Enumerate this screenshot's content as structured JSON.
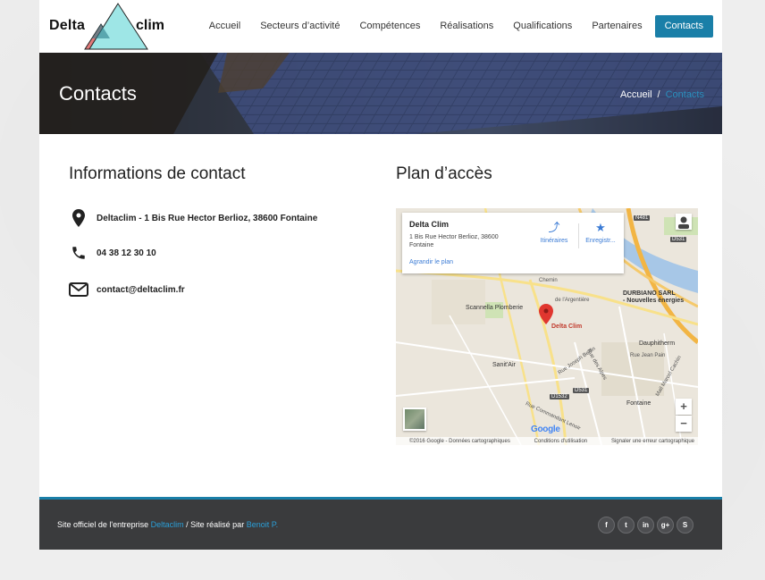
{
  "logo": {
    "text_left": "Delta",
    "text_right": "clim"
  },
  "nav": {
    "items": [
      {
        "label": "Accueil"
      },
      {
        "label": "Secteurs d’activité"
      },
      {
        "label": "Compétences"
      },
      {
        "label": "Réalisations"
      },
      {
        "label": "Qualifications"
      },
      {
        "label": "Partenaires"
      },
      {
        "label": "Contacts"
      }
    ],
    "active": "Contacts",
    "active_color": "#1a7fa8"
  },
  "banner": {
    "title": "Contacts",
    "breadcrumb": {
      "home": "Accueil",
      "separator": "/",
      "current": "Contacts"
    }
  },
  "contact_info": {
    "heading": "Informations de contact",
    "address": "Deltaclim - 1 Bis Rue Hector Berlioz, 38600 Fontaine",
    "phone": "04 38 12 30 10",
    "email": "contact@deltaclim.fr",
    "icons": [
      "map-pin-icon",
      "phone-icon",
      "envelope-icon"
    ]
  },
  "access": {
    "heading": "Plan d’accès",
    "map": {
      "card": {
        "name": "Delta Clim",
        "address_line1": "1 Bis Rue Hector Berlioz, 38600",
        "address_line2": "Fontaine",
        "enlarge": "Agrandir le plan",
        "directions": "Itinéraires",
        "save": "Enregistr..."
      },
      "labels": {
        "marker": "Delta Clim",
        "scannella": "Scannella Plomberie",
        "durbiano": "DURBIANO SARL",
        "nouvelles": "- Nouvelles énergies",
        "dauphitherm": "Dauphitherm",
        "sanitair": "Sanit'Air",
        "fontaine": "Fontaine",
        "chemin": "Chemin",
        "argentiere": "de l'Argentière",
        "rue_jean_pain": "Rue Jean Pain",
        "joseph_bertin": "Rue Joseph Bertin",
        "rue_alpes": "Rue des Alpes",
        "marcel_cachin": "Mail Marcel Cachin",
        "commandant_lenoir": "Rue Commandant Lenoir",
        "n481": "N481",
        "d531_top": "D531",
        "d531_bottom": "D531",
        "d1532": "D1532"
      },
      "zoom_in": "+",
      "zoom_out": "−",
      "google": "Google",
      "attribution_left": "©2016 Google - Données cartographiques",
      "attribution_mid": "Conditions d'utilisation",
      "attribution_right": "Signaler une erreur cartographique"
    }
  },
  "footer": {
    "prefix": "Site officiel de l'entreprise",
    "company_link": "Deltaclim",
    "middle": "/ Site réalisé par",
    "author_link": "Benoit P.",
    "accent_color": "#1a7fa8",
    "socials": [
      {
        "icon": "facebook-icon",
        "glyph": "f"
      },
      {
        "icon": "twitter-icon",
        "glyph": "t"
      },
      {
        "icon": "linkedin-icon",
        "glyph": "in"
      },
      {
        "icon": "googleplus-icon",
        "glyph": "g+"
      },
      {
        "icon": "skype-icon",
        "glyph": "S"
      }
    ]
  }
}
